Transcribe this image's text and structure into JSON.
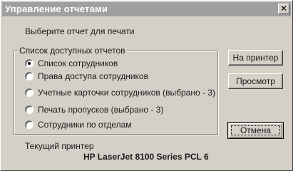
{
  "window": {
    "title": "Управление отчетами",
    "close_glyph": "✕",
    "close_icon": "close-icon"
  },
  "prompt": "Выберите отчет для печати",
  "report_group": {
    "legend": "Список доступных отчетов",
    "options": [
      {
        "label": "Список сотрудников",
        "selected": true
      },
      {
        "label": "Права доступа сотрудников",
        "selected": false
      },
      {
        "label": "Учетные карточки сотрудников  (выбрано - 3)",
        "selected": false
      },
      {
        "label": "Печать пропусков (выбрано - 3)",
        "selected": false
      },
      {
        "label": "Сотрудники по отделам",
        "selected": false
      }
    ]
  },
  "buttons": {
    "to_printer": "На принтер",
    "preview": "Просмотр",
    "cancel": "Отмена"
  },
  "printer": {
    "label": "Текущий принтер",
    "name": "HP LaserJet 8100 Series PCL 6"
  },
  "colors": {
    "dialog_face": "#d4d0c8",
    "titlebar": "#a0a0a0",
    "title_text": "#ffffff"
  }
}
